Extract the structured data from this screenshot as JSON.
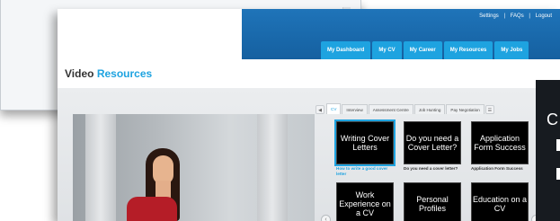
{
  "header": {
    "top_links": [
      "Settings",
      "FAQs",
      "Logout"
    ],
    "nav_tabs": [
      "My Dashboard",
      "My CV",
      "My Career",
      "My Resources",
      "My Jobs"
    ]
  },
  "page": {
    "title_prefix": "Video",
    "title_accent": "Resources"
  },
  "resource_tabs": [
    "CV",
    "Interview",
    "Assessment Centre",
    "Job Hunting",
    "Pay Negotiation"
  ],
  "tiles": [
    {
      "text": "Writing Cover Letters",
      "caption": "How to write a good cover letter"
    },
    {
      "text": "Do you need a Cover Letter?",
      "caption": "Do you need a cover letter?"
    },
    {
      "text": "Application Form Success",
      "caption": "Application Form Success"
    },
    {
      "text": "Work Experience on a CV",
      "caption": ""
    },
    {
      "text": "Personal Profiles",
      "caption": ""
    },
    {
      "text": "Education on a CV",
      "caption": ""
    }
  ],
  "overlay": {
    "letter": "C"
  },
  "colors": {
    "header_blue": "#1560a0",
    "tab_blue": "#1ea3e0",
    "tile_black": "#000000"
  },
  "icons": {
    "prev": "chevron-left-icon",
    "next": "chevron-right-icon",
    "tab_scroll": "tab-scroll-icon"
  }
}
